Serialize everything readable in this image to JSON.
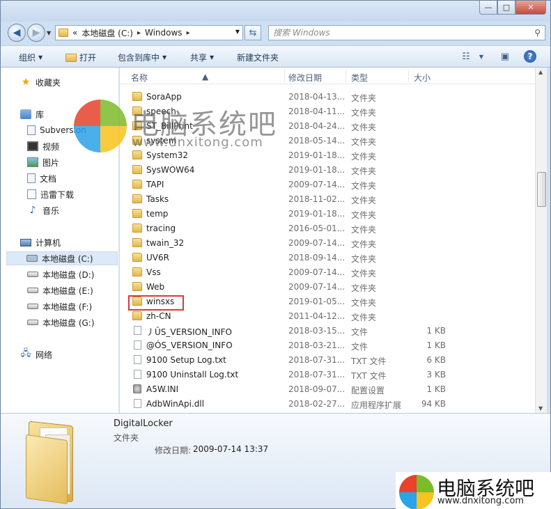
{
  "window": {
    "controls": {
      "minimize": "—",
      "maximize": "□",
      "close": "✕"
    }
  },
  "address": {
    "overflow": "«",
    "crumbs": [
      "本地磁盘 (C:)",
      "Windows"
    ],
    "separator": "▸"
  },
  "search": {
    "placeholder": "搜索 Windows"
  },
  "toolbar": {
    "organize": "组织",
    "open": "打开",
    "include_in_library": "包含到库中",
    "share": "共享",
    "new_folder": "新建文件夹"
  },
  "sidebar": {
    "favorites": "收藏夹",
    "libraries": "库",
    "library_items": [
      "Subversion",
      "视频",
      "图片",
      "文档",
      "迅雷下载",
      "音乐"
    ],
    "computer": "计算机",
    "drives": [
      "本地磁盘 (C:)",
      "本地磁盘 (D:)",
      "本地磁盘 (E:)",
      "本地磁盘 (F:)",
      "本地磁盘 (G:)"
    ],
    "network": "网络"
  },
  "columns": {
    "name": "名称",
    "date": "修改日期",
    "type": "类型",
    "size": "大小"
  },
  "files": [
    {
      "name": "SoraApp",
      "date": "2018-04-13...",
      "type": "文件夹",
      "size": "",
      "kind": "folder"
    },
    {
      "name": "speech",
      "date": "2018-04-11...",
      "type": "文件夹",
      "size": "",
      "kind": "folder"
    },
    {
      "name": "ST_BillPrint",
      "date": "2018-04-24...",
      "type": "文件夹",
      "size": "",
      "kind": "folder"
    },
    {
      "name": "system",
      "date": "2018-05-14...",
      "type": "文件夹",
      "size": "",
      "kind": "folder"
    },
    {
      "name": "System32",
      "date": "2019-01-18...",
      "type": "文件夹",
      "size": "",
      "kind": "folder"
    },
    {
      "name": "SysWOW64",
      "date": "2019-01-18...",
      "type": "文件夹",
      "size": "",
      "kind": "folder"
    },
    {
      "name": "TAPI",
      "date": "2009-07-14...",
      "type": "文件夹",
      "size": "",
      "kind": "folder"
    },
    {
      "name": "Tasks",
      "date": "2018-11-02...",
      "type": "文件夹",
      "size": "",
      "kind": "folder"
    },
    {
      "name": "temp",
      "date": "2019-01-18...",
      "type": "文件夹",
      "size": "",
      "kind": "folder"
    },
    {
      "name": "tracing",
      "date": "2016-05-01...",
      "type": "文件夹",
      "size": "",
      "kind": "folder"
    },
    {
      "name": "twain_32",
      "date": "2009-07-14...",
      "type": "文件夹",
      "size": "",
      "kind": "folder"
    },
    {
      "name": "UV6R",
      "date": "2018-09-14...",
      "type": "文件夹",
      "size": "",
      "kind": "folder"
    },
    {
      "name": "Vss",
      "date": "2009-07-14...",
      "type": "文件夹",
      "size": "",
      "kind": "folder"
    },
    {
      "name": "Web",
      "date": "2009-07-14...",
      "type": "文件夹",
      "size": "",
      "kind": "folder"
    },
    {
      "name": "winsxs",
      "date": "2019-01-05...",
      "type": "文件夹",
      "size": "",
      "kind": "folder"
    },
    {
      "name": "zh-CN",
      "date": "2011-04-12...",
      "type": "文件夹",
      "size": "",
      "kind": "folder"
    },
    {
      "name": "丿ÛS_VERSION_INFO",
      "date": "2018-03-15...",
      "type": "文件",
      "size": "1 KB",
      "kind": "file"
    },
    {
      "name": "@ÓS_VERSION_INFO",
      "date": "2018-03-21...",
      "type": "文件",
      "size": "1 KB",
      "kind": "file"
    },
    {
      "name": "9100 Setup Log.txt",
      "date": "2018-07-31...",
      "type": "TXT 文件",
      "size": "6 KB",
      "kind": "file"
    },
    {
      "name": "9100 Uninstall Log.txt",
      "date": "2018-07-31...",
      "type": "TXT 文件",
      "size": "3 KB",
      "kind": "file"
    },
    {
      "name": "A5W.INI",
      "date": "2018-09-07...",
      "type": "配置设置",
      "size": "1 KB",
      "kind": "cfg"
    },
    {
      "name": "AdbWinApi.dll",
      "date": "2018-02-27...",
      "type": "应用程序扩展",
      "size": "94 KB",
      "kind": "file"
    }
  ],
  "details": {
    "name": "DigitalLocker",
    "type": "文件夹",
    "modified_label": "修改日期:",
    "modified_value": "2009-07-14 13:37"
  },
  "watermark": {
    "brand": "电脑系统吧",
    "url": "www.dnxitong.com"
  }
}
